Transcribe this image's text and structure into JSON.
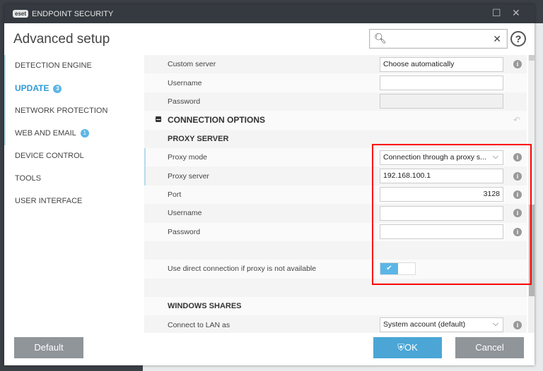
{
  "window": {
    "logo": "eset",
    "title": "ENDPOINT SECURITY"
  },
  "header": {
    "title": "Advanced setup",
    "search_value": "",
    "help": "?"
  },
  "sidebar": {
    "items": [
      {
        "label": "DETECTION ENGINE"
      },
      {
        "label": "UPDATE",
        "badge": "3",
        "active": true
      },
      {
        "label": "NETWORK PROTECTION"
      },
      {
        "label": "WEB AND EMAIL",
        "badge": "1"
      },
      {
        "label": "DEVICE CONTROL"
      },
      {
        "label": "TOOLS"
      },
      {
        "label": "USER INTERFACE"
      }
    ]
  },
  "content": {
    "custom_server": {
      "label": "Custom server",
      "value": "Choose automatically"
    },
    "username": {
      "label": "Username",
      "value": ""
    },
    "password": {
      "label": "Password",
      "value": ""
    },
    "connection_options": "CONNECTION OPTIONS",
    "proxy_server_header": "PROXY SERVER",
    "proxy_mode": {
      "label": "Proxy mode",
      "value": "Connection through a proxy s..."
    },
    "proxy_server": {
      "label": "Proxy server",
      "value": "192.168.100.1"
    },
    "port": {
      "label": "Port",
      "value": "3128"
    },
    "proxy_username": {
      "label": "Username",
      "value": ""
    },
    "proxy_password": {
      "label": "Password",
      "value": ""
    },
    "direct_connection": {
      "label": "Use direct connection if proxy is not available",
      "enabled": true
    },
    "windows_shares": "WINDOWS SHARES",
    "connect_lan": {
      "label": "Connect to LAN as",
      "value": "System account (default)"
    }
  },
  "footer": {
    "default": "Default",
    "ok": "OK",
    "cancel": "Cancel"
  },
  "colors": {
    "accent": "#4ba6d6",
    "highlight": "#ff0000",
    "titlebar": "#343a40"
  }
}
